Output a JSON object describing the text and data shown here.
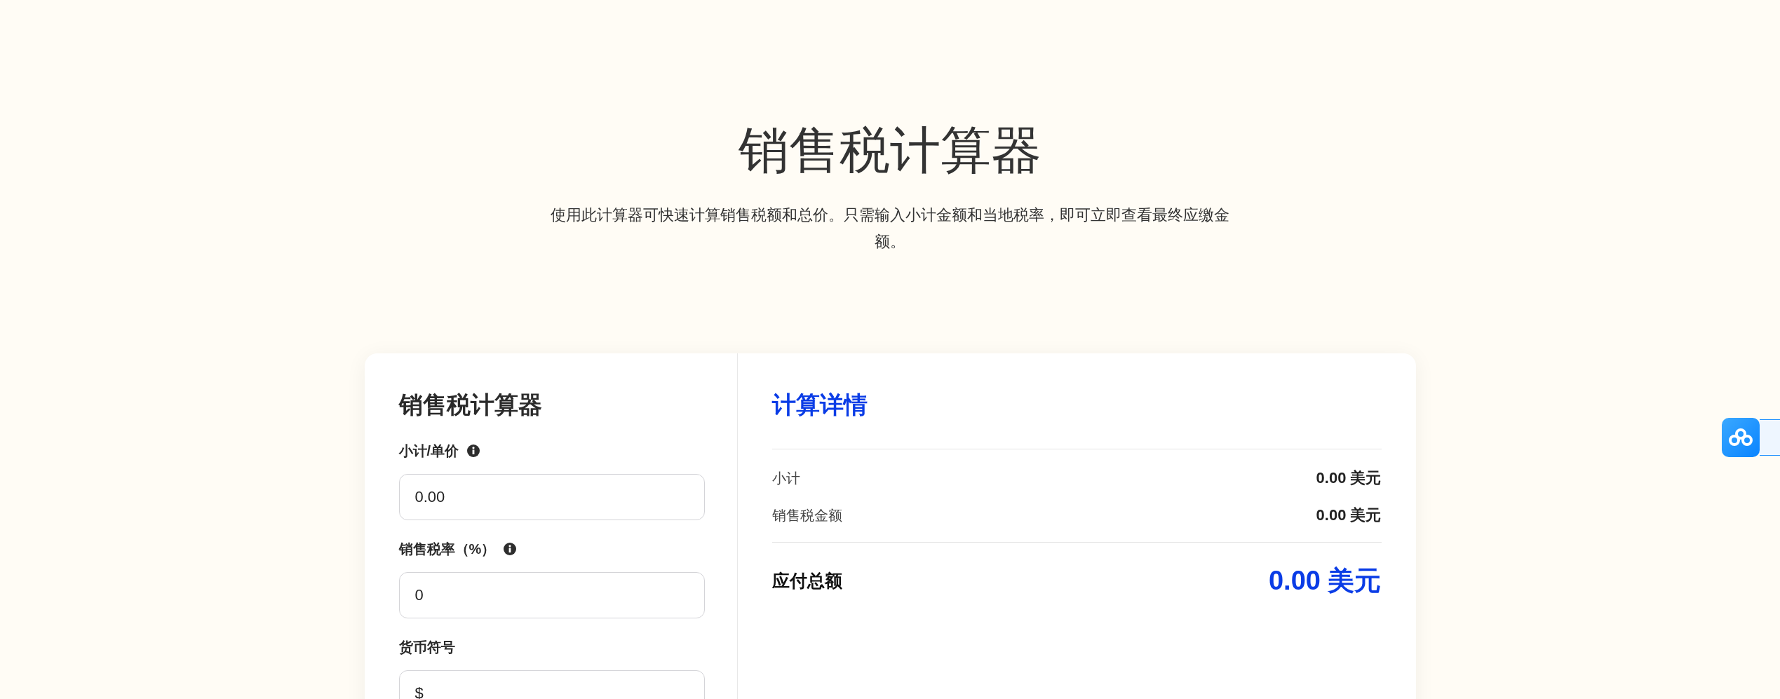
{
  "header": {
    "title": "销售税计算器",
    "description": "使用此计算器可快速计算销售税额和总价。只需输入小计金额和当地税率，即可立即查看最终应缴金额。"
  },
  "form": {
    "title": "销售税计算器",
    "fields": [
      {
        "label": "小计/单价",
        "value": "0.00",
        "info": true
      },
      {
        "label": "销售税率（%）",
        "value": "0",
        "info": true
      },
      {
        "label": "货币符号",
        "value": "$",
        "info": false
      }
    ]
  },
  "details": {
    "title": "计算详情",
    "rows": [
      {
        "label": "小计",
        "value": "0.00 美元"
      },
      {
        "label": "销售税金额",
        "value": "0.00 美元"
      }
    ],
    "total": {
      "label": "应付总额",
      "value": "0.00 美元"
    }
  }
}
